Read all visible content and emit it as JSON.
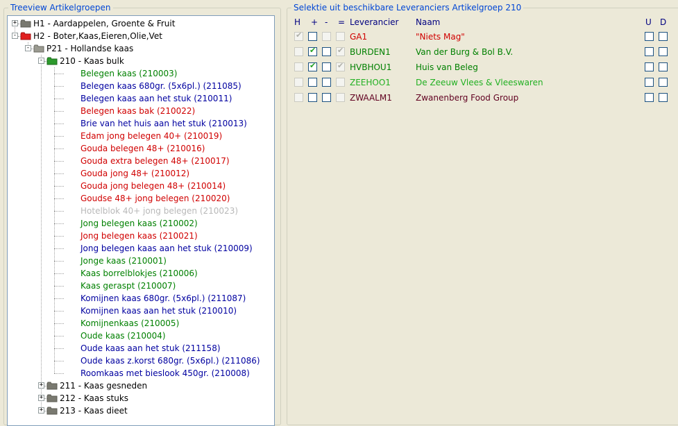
{
  "tree_panel": {
    "title": "Treeview Artikelgroepen"
  },
  "tree": [
    {
      "label": "H1 - Aardappelen, Groente & Fruit",
      "color": "#000000",
      "level": 0,
      "expander": "+",
      "icon": "folder-gray-icon"
    },
    {
      "label": "H2 - Boter,Kaas,Eieren,Olie,Vet",
      "color": "#000000",
      "level": 0,
      "expander": "-",
      "icon": "folder-red-icon"
    },
    {
      "label": "P21 - Hollandse kaas",
      "color": "#000000",
      "level": 1,
      "expander": "-",
      "icon": "folder-open-gray-icon"
    },
    {
      "label": "210 - Kaas bulk",
      "color": "#000000",
      "level": 2,
      "expander": "-",
      "icon": "folder-green-icon"
    },
    {
      "label": "Belegen kaas (210003)",
      "color": "#008000",
      "level": 3
    },
    {
      "label": "Belegen kaas 680gr. (5x6pl.) (211085)",
      "color": "#0000A0",
      "level": 3
    },
    {
      "label": "Belegen kaas aan het stuk (210011)",
      "color": "#0000A0",
      "level": 3
    },
    {
      "label": "Belegen kaas bak (210022)",
      "color": "#D00000",
      "level": 3
    },
    {
      "label": "Brie van het huis aan het stuk (210013)",
      "color": "#0000A0",
      "level": 3
    },
    {
      "label": "Edam jong belegen 40+ (210019)",
      "color": "#D00000",
      "level": 3
    },
    {
      "label": "Gouda belegen 48+ (210016)",
      "color": "#D00000",
      "level": 3
    },
    {
      "label": "Gouda extra belegen 48+ (210017)",
      "color": "#D00000",
      "level": 3
    },
    {
      "label": "Gouda jong 48+ (210012)",
      "color": "#D00000",
      "level": 3
    },
    {
      "label": "Gouda jong belegen 48+ (210014)",
      "color": "#D00000",
      "level": 3
    },
    {
      "label": "Goudse 48+ jong belegen (210020)",
      "color": "#D00000",
      "level": 3
    },
    {
      "label": "Hotelblok 40+ jong belegen (210023)",
      "color": "#B8B8B8",
      "level": 3
    },
    {
      "label": "Jong belegen kaas (210002)",
      "color": "#008000",
      "level": 3
    },
    {
      "label": "Jong belegen kaas (210021)",
      "color": "#D00000",
      "level": 3
    },
    {
      "label": "Jong belegen kaas aan het stuk (210009)",
      "color": "#0000A0",
      "level": 3
    },
    {
      "label": "Jonge kaas (210001)",
      "color": "#008000",
      "level": 3
    },
    {
      "label": "Kaas borrelblokjes (210006)",
      "color": "#008000",
      "level": 3
    },
    {
      "label": "Kaas geraspt (210007)",
      "color": "#008000",
      "level": 3
    },
    {
      "label": "Komijnen kaas 680gr. (5x6pl.) (211087)",
      "color": "#0000A0",
      "level": 3
    },
    {
      "label": "Komijnen kaas aan het stuk (210010)",
      "color": "#0000A0",
      "level": 3
    },
    {
      "label": "Komijnenkaas (210005)",
      "color": "#008000",
      "level": 3
    },
    {
      "label": "Oude kaas (210004)",
      "color": "#008000",
      "level": 3
    },
    {
      "label": "Oude kaas aan het stuk (211158)",
      "color": "#0000A0",
      "level": 3
    },
    {
      "label": "Oude kaas z.korst 680gr. (5x6pl.) (211086)",
      "color": "#0000A0",
      "level": 3
    },
    {
      "label": "Roomkaas met bieslook 450gr. (210008)",
      "color": "#0000A0",
      "level": 3
    },
    {
      "label": "211 - Kaas gesneden",
      "color": "#000000",
      "level": 2,
      "expander": "+",
      "icon": "folder-gray-icon"
    },
    {
      "label": "212 - Kaas stuks",
      "color": "#000000",
      "level": 2,
      "expander": "+",
      "icon": "folder-gray-icon"
    },
    {
      "label": "213 - Kaas dieet",
      "color": "#000000",
      "level": 2,
      "expander": "+",
      "icon": "folder-gray-icon"
    }
  ],
  "supplier_panel": {
    "title": "Selektie uit beschikbare Leveranciers Artikelgroep 210",
    "headers": {
      "h": "H",
      "plus": "+",
      "minus": "-",
      "eq": "=",
      "supplier": "Leverancier",
      "name": "Naam",
      "u": "U",
      "d": "D"
    }
  },
  "suppliers": [
    {
      "code": "GA1",
      "name": "\"Niets Mag\"",
      "color": "#D00000",
      "h": "checked-disabled",
      "plus": "empty",
      "minus": "disabled",
      "eq": "disabled",
      "u": "empty",
      "d": "empty"
    },
    {
      "code": "BURDEN1",
      "name": "Van der Burg & Bol B.V.",
      "color": "#008000",
      "h": "disabled",
      "plus": "checked",
      "minus": "empty",
      "eq": "checked-disabled",
      "u": "empty",
      "d": "empty"
    },
    {
      "code": "HVBHOU1",
      "name": "Huis van Beleg",
      "color": "#008000",
      "h": "disabled",
      "plus": "checked",
      "minus": "empty",
      "eq": "checked-disabled",
      "u": "empty",
      "d": "empty"
    },
    {
      "code": "ZEEHOO1",
      "name": "De Zeeuw Vlees & Vleeswaren",
      "color": "#22B022",
      "h": "disabled",
      "plus": "empty",
      "minus": "empty",
      "eq": "disabled",
      "u": "empty",
      "d": "empty"
    },
    {
      "code": "ZWAALM1",
      "name": "Zwanenberg Food Group",
      "color": "#600020",
      "h": "disabled",
      "plus": "empty",
      "minus": "empty",
      "eq": "disabled",
      "u": "empty",
      "d": "empty"
    }
  ]
}
